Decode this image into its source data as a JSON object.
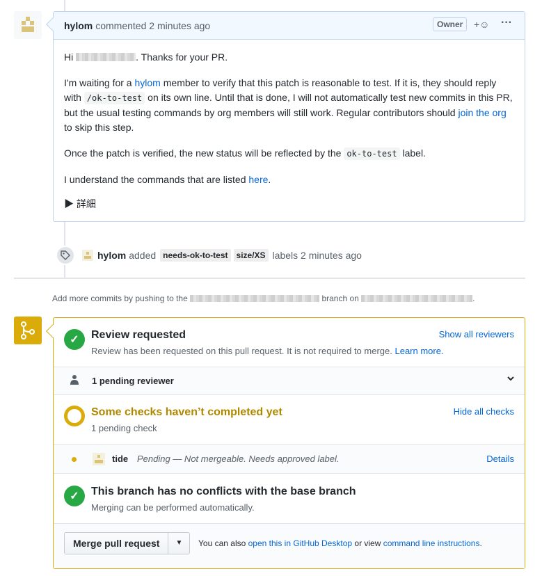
{
  "comment": {
    "author": "hylom",
    "action": "commented 2 minutes ago",
    "badge": "Owner",
    "react": "+☺",
    "more": "···",
    "greeting_pre": "Hi",
    "greeting_post": ". Thanks for your PR.",
    "p2_a": "I'm waiting for a",
    "p2_link": "hylom",
    "p2_b": "member to verify that this patch is reasonable to test. If it is, they should reply with",
    "p2_code": "/ok-to-test",
    "p2_c": "on its own line. Until that is done, I will not automatically test new commits in this PR, but the usual testing commands by org members will still work. Regular contributors should",
    "p2_link2": "join the org",
    "p2_d": "to skip this step.",
    "p3_a": "Once the patch is verified, the new status will be reflected by the",
    "p3_code": "ok-to-test",
    "p3_b": "label.",
    "p4_a": "I understand the commands that are listed",
    "p4_link": "here",
    "p4_b": ".",
    "details": "▶ 詳細"
  },
  "label_event": {
    "author": "hylom",
    "action": "added",
    "labels": [
      "needs-ok-to-test",
      "size/XS"
    ],
    "suffix": "labels 2 minutes ago"
  },
  "push_note": {
    "a": "Add more commits by pushing to the",
    "b": "branch on",
    "c": "."
  },
  "merge": {
    "review_title": "Review requested",
    "review_sub": "Review has been requested on this pull request. It is not required to merge.",
    "review_learn": "Learn more.",
    "show_reviewers": "Show all reviewers",
    "pending_reviewer": "1 pending reviewer",
    "checks_title": "Some checks haven’t completed yet",
    "checks_sub": "1 pending check",
    "hide_checks": "Hide all checks",
    "check_name": "tide",
    "check_status": "Pending — Not mergeable. Needs approved label.",
    "check_details": "Details",
    "conflict_title": "This branch has no conflicts with the base branch",
    "conflict_sub": "Merging can be performed automatically.",
    "merge_button": "Merge pull request",
    "note_a": "You can also",
    "note_link1": "open this in GitHub Desktop",
    "note_b": "or view",
    "note_link2": "command line instructions",
    "note_c": "."
  },
  "colors": {
    "accent_blue": "#0366d6",
    "success": "#28a745",
    "pending": "#dbab09"
  }
}
